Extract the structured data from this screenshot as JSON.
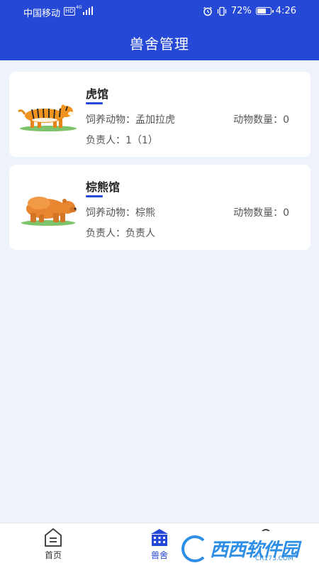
{
  "status_bar": {
    "carrier": "中国移动",
    "hd": "HD",
    "network": "4G",
    "battery": "72%",
    "battery_level": 0.72,
    "time": "4:26"
  },
  "header": {
    "title": "兽舍管理"
  },
  "enclosures": [
    {
      "name": "虎馆",
      "feed_label": "饲养动物：孟加拉虎",
      "count_label": "动物数量：0",
      "keeper_label": "负责人：1（1）",
      "image": "tiger-image"
    },
    {
      "name": "棕熊馆",
      "feed_label": "饲养动物：棕熊",
      "count_label": "动物数量：0",
      "keeper_label": "负责人：负责人",
      "image": "bear-image"
    }
  ],
  "tabbar": {
    "home": "首页",
    "zoo": "兽舍",
    "me": "我的",
    "active": "兽舍",
    "active_color": "#2548d6"
  },
  "watermark": {
    "brand": "西西软件园",
    "url": "CR173.COM"
  },
  "colors": {
    "primary": "#2548d6",
    "background": "#eef2fb"
  }
}
